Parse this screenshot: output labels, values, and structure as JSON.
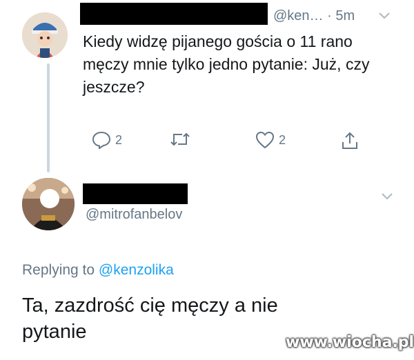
{
  "tweet": {
    "handle": "@ken…",
    "time": "· 5m",
    "text": "Kiedy widzę pijanego gościa o 11 rano męczy mnie tylko jedno pytanie: Już, czy jeszcze?",
    "reply_count": "2",
    "like_count": "2"
  },
  "reply": {
    "handle": "@mitrofanbelov",
    "replying_prefix": "Replying to",
    "replying_mention": "@kenzolika",
    "text": "Ta, zazdrość cię męczy a nie pytanie"
  },
  "watermark": "www.wiocha.pl",
  "icons": {
    "reply": "reply-icon",
    "retweet": "retweet-icon",
    "like": "heart-icon",
    "share": "share-icon",
    "menu": "chevron-down-icon"
  },
  "colors": {
    "text": "#14171a",
    "secondary": "#657786",
    "link": "#1da1f2",
    "thread_line": "#ccd6dd"
  }
}
